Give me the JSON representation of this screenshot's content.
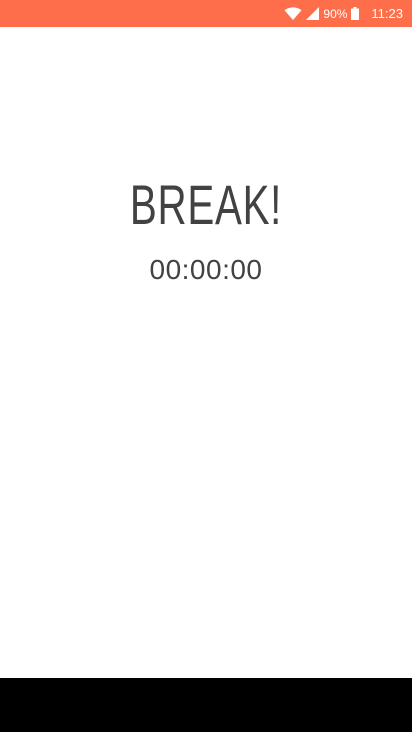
{
  "colors": {
    "status_bar": "#ff6e4a",
    "text": "#424242",
    "background": "#ffffff",
    "nav_bar": "#000000"
  },
  "status_bar": {
    "icons": [
      "wifi-icon",
      "signal-icon",
      "battery-icon"
    ],
    "battery": "90%",
    "time": "11:23"
  },
  "main": {
    "title": "BREAK!",
    "timer": "00:00:00"
  }
}
